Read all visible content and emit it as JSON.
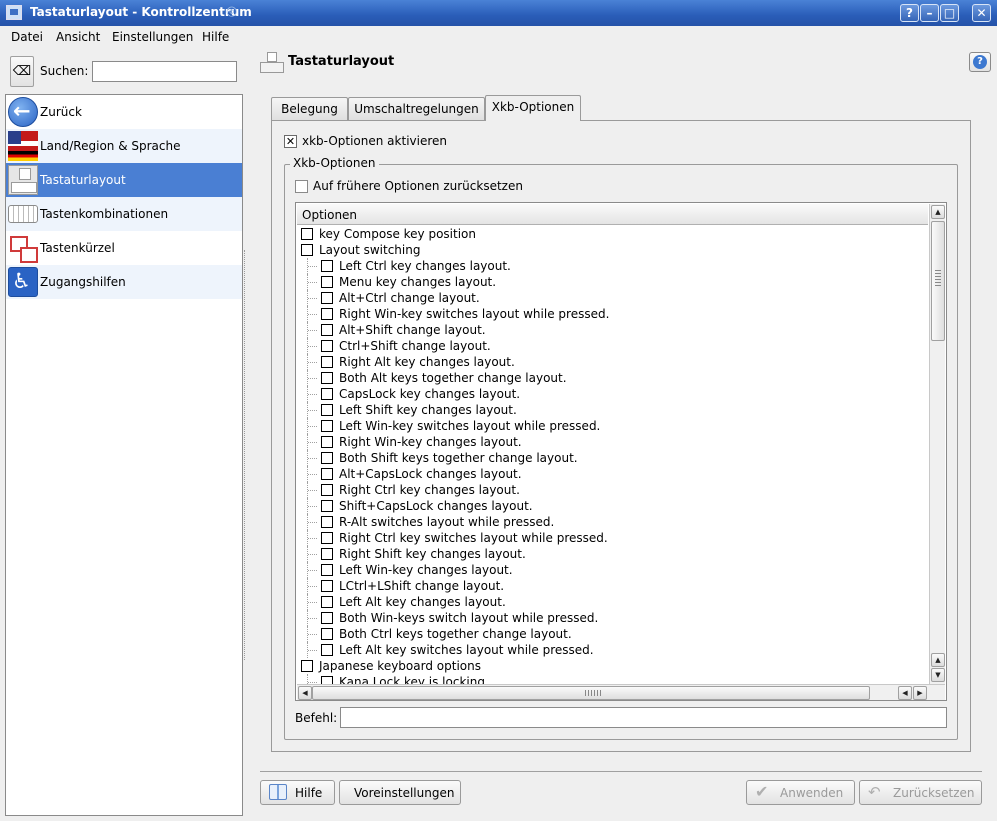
{
  "window": {
    "title": "Tastaturlayout - Kontrollzentrum",
    "controls": [
      "?",
      "–",
      "□",
      "✕"
    ]
  },
  "menu": [
    "Datei",
    "Ansicht",
    "Einstellungen",
    "Hilfe"
  ],
  "search": {
    "label": "Suchen:",
    "value": ""
  },
  "sidebar": {
    "items": [
      {
        "label": "Zurück",
        "icon": "back-arrow-icon"
      },
      {
        "label": "Land/Region & Sprache",
        "icon": "flags-icon"
      },
      {
        "label": "Tastaturlayout",
        "icon": "keyboard-layout-icon",
        "selected": true
      },
      {
        "label": "Tastenkombinationen",
        "icon": "keyboard-icon"
      },
      {
        "label": "Tastenkürzel",
        "icon": "shortcut-keys-icon"
      },
      {
        "label": "Zugangshilfen",
        "icon": "accessibility-icon"
      }
    ]
  },
  "page": {
    "title": "Tastaturlayout"
  },
  "tabs": [
    "Belegung",
    "Umschaltregelungen",
    "Xkb-Optionen"
  ],
  "active_tab": "Xkb-Optionen",
  "enable_xkb": {
    "label": "xkb-Optionen aktivieren",
    "checked": true
  },
  "group": {
    "title": "Xkb-Optionen",
    "reset_label": "Auf frühere Optionen zurücksetzen",
    "reset_checked": false
  },
  "tree": {
    "header": "Optionen",
    "rows": [
      {
        "label": "key Compose key position",
        "level": 0
      },
      {
        "label": "Layout switching",
        "level": 0
      },
      {
        "label": "Left Ctrl key changes layout.",
        "level": 1
      },
      {
        "label": "Menu key changes layout.",
        "level": 1
      },
      {
        "label": "Alt+Ctrl change layout.",
        "level": 1
      },
      {
        "label": "Right Win-key switches layout while pressed.",
        "level": 1
      },
      {
        "label": "Alt+Shift change layout.",
        "level": 1
      },
      {
        "label": "Ctrl+Shift change layout.",
        "level": 1
      },
      {
        "label": "Right Alt key changes layout.",
        "level": 1
      },
      {
        "label": "Both Alt keys together change layout.",
        "level": 1
      },
      {
        "label": "CapsLock key changes layout.",
        "level": 1
      },
      {
        "label": "Left Shift key changes layout.",
        "level": 1
      },
      {
        "label": "Left Win-key switches layout while pressed.",
        "level": 1
      },
      {
        "label": "Right Win-key changes layout.",
        "level": 1
      },
      {
        "label": "Both Shift keys together change layout.",
        "level": 1
      },
      {
        "label": "Alt+CapsLock changes layout.",
        "level": 1
      },
      {
        "label": "Right Ctrl key changes layout.",
        "level": 1
      },
      {
        "label": "Shift+CapsLock changes layout.",
        "level": 1
      },
      {
        "label": "R-Alt switches layout while pressed.",
        "level": 1
      },
      {
        "label": "Right Ctrl key switches layout while pressed.",
        "level": 1
      },
      {
        "label": "Right Shift key changes layout.",
        "level": 1
      },
      {
        "label": "Left Win-key changes layout.",
        "level": 1
      },
      {
        "label": "LCtrl+LShift change layout.",
        "level": 1
      },
      {
        "label": "Left Alt key changes layout.",
        "level": 1
      },
      {
        "label": "Both Win-keys switch layout while pressed.",
        "level": 1
      },
      {
        "label": "Both Ctrl keys together change layout.",
        "level": 1
      },
      {
        "label": "Left Alt key switches layout while pressed.",
        "level": 1
      },
      {
        "label": "Japanese keyboard options",
        "level": 0
      },
      {
        "label": "Kana Lock key is locking",
        "level": 1
      }
    ]
  },
  "command": {
    "label": "Befehl:",
    "value": ""
  },
  "buttons": {
    "help": "Hilfe",
    "defaults": "Voreinstellungen",
    "apply": "Anwenden",
    "reset": "Zurücksetzen"
  },
  "colors": {
    "titlebar": "#2a5db8",
    "selection": "#4a7fd3"
  }
}
